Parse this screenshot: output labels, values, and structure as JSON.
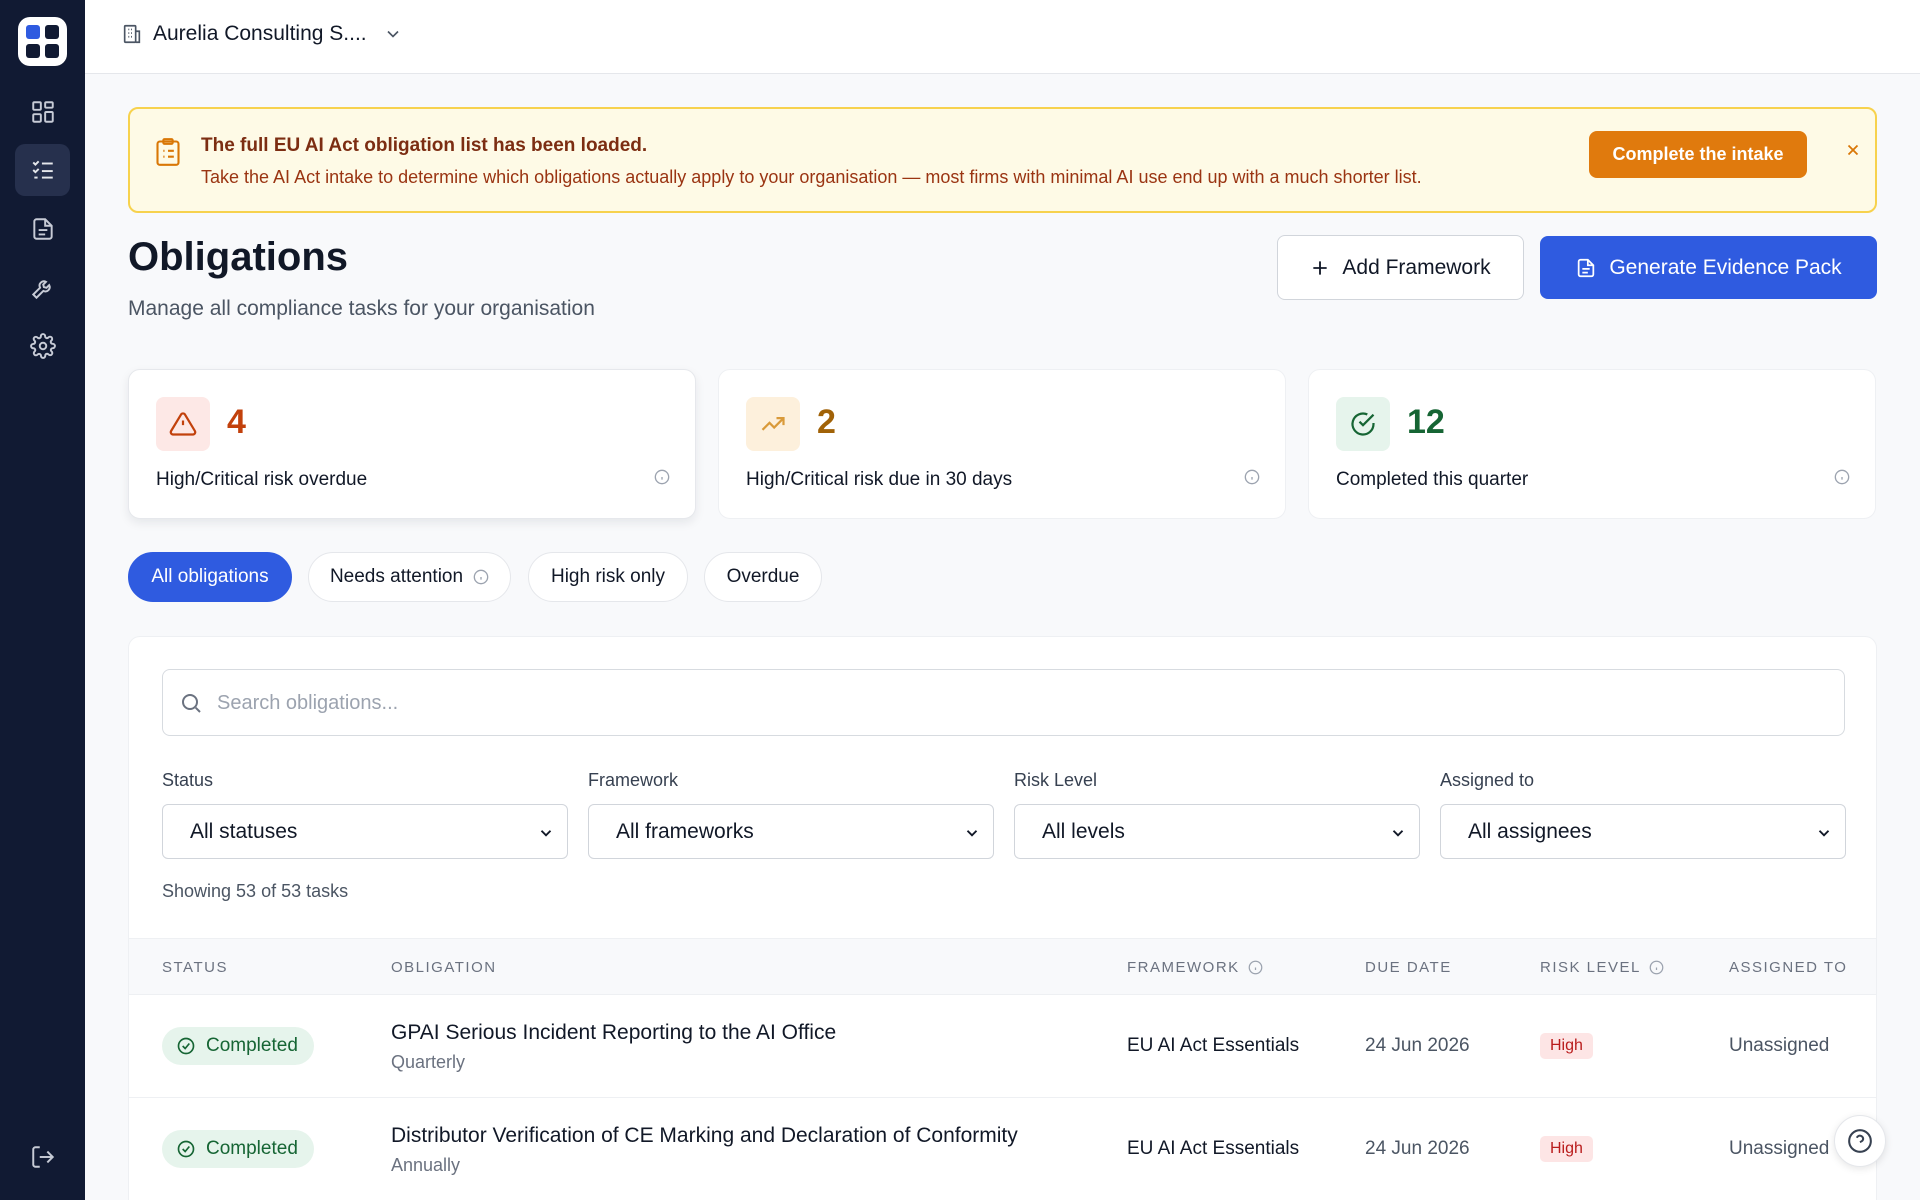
{
  "topbar": {
    "org_name": "Aurelia Consulting S...."
  },
  "banner": {
    "title": "The full EU AI Act obligation list has been loaded.",
    "text": "Take the AI Act intake to determine which obligations actually apply to your organisation — most firms with minimal AI use end up with a much shorter list.",
    "button": "Complete the intake"
  },
  "header": {
    "title": "Obligations",
    "subtitle": "Manage all compliance tasks for your organisation",
    "add_button": "Add Framework",
    "generate_button": "Generate Evidence Pack"
  },
  "stats": [
    {
      "value": "4",
      "label": "High/Critical risk overdue",
      "color": "#c2410c"
    },
    {
      "value": "2",
      "label": "High/Critical risk due in 30 days",
      "color": "#a16207"
    },
    {
      "value": "12",
      "label": "Completed this quarter",
      "color": "#166534"
    }
  ],
  "chips": [
    {
      "label": "All obligations",
      "active": true
    },
    {
      "label": "Needs attention",
      "active": false
    },
    {
      "label": "High risk only",
      "active": false
    },
    {
      "label": "Overdue",
      "active": false
    }
  ],
  "search": {
    "placeholder": "Search obligations..."
  },
  "filters": [
    {
      "label": "Status",
      "value": "All statuses"
    },
    {
      "label": "Framework",
      "value": "All frameworks"
    },
    {
      "label": "Risk Level",
      "value": "All levels"
    },
    {
      "label": "Assigned to",
      "value": "All assignees"
    }
  ],
  "showing": "Showing 53 of 53 tasks",
  "table": {
    "columns": [
      "STATUS",
      "OBLIGATION",
      "FRAMEWORK",
      "DUE DATE",
      "RISK LEVEL",
      "ASSIGNED TO"
    ],
    "rows": [
      {
        "status": "Completed",
        "title": "GPAI Serious Incident Reporting to the AI Office",
        "frequency": "Quarterly",
        "framework": "EU AI Act Essentials",
        "due": "24 Jun 2026",
        "risk": "High",
        "assigned": "Unassigned"
      },
      {
        "status": "Completed",
        "title": "Distributor Verification of CE Marking and Declaration of Conformity",
        "frequency": "Annually",
        "framework": "EU AI Act Essentials",
        "due": "24 Jun 2026",
        "risk": "High",
        "assigned": "Unassigned"
      }
    ]
  },
  "colors": {
    "primary": "#2f5be0",
    "sidebar": "#111a33",
    "warning_button": "#e07a0d",
    "banner_bg": "#fefae6"
  }
}
